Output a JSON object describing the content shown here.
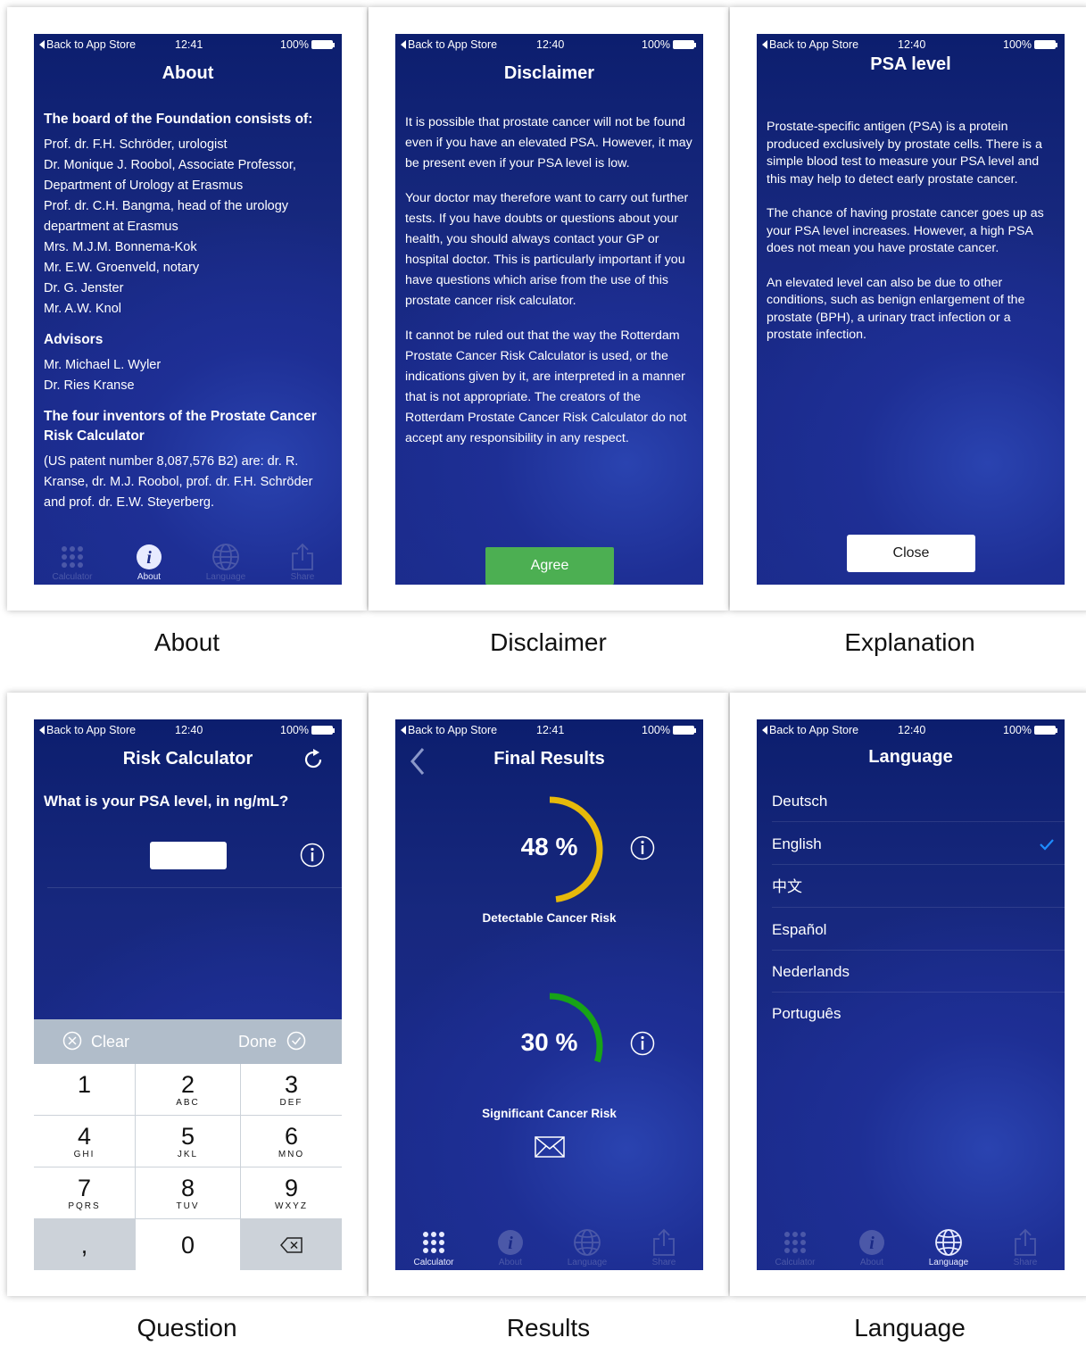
{
  "status": {
    "back": "Back to App Store",
    "battery": "100%"
  },
  "tabs": {
    "calculator": "Calculator",
    "about": "About",
    "language": "Language",
    "share": "Share"
  },
  "captions": {
    "about": "About",
    "disclaimer": "Disclaimer",
    "explanation": "Explanation",
    "question": "Question",
    "results": "Results",
    "language": "Language"
  },
  "about": {
    "time": "12:41",
    "title": "About",
    "board_heading": "The board of the Foundation consists of:",
    "board": [
      "Prof. dr. F.H. Schröder, urologist",
      "Dr. Monique J. Roobol, Associate Professor,",
      "Department of Urology at Erasmus",
      "Prof. dr. C.H. Bangma, head of the urology",
      "department at Erasmus",
      "Mrs. M.J.M. Bonnema-Kok",
      "Mr. E.W. Groenveld, notary",
      "Dr. G. Jenster",
      "Mr. A.W. Knol"
    ],
    "advisors_heading": "Advisors",
    "advisors": [
      "Mr. Michael L. Wyler",
      "Dr. Ries Kranse"
    ],
    "inventors_heading": "The four inventors of the Prostate Cancer Risk Calculator",
    "inventors_text": "(US patent number 8,087,576 B2) are: dr. R. Kranse, dr. M.J. Roobol, prof. dr. F.H. Schröder and prof. dr. E.W. Steyerberg."
  },
  "disclaimer": {
    "time": "12:40",
    "title": "Disclaimer",
    "p1": "It is possible that prostate cancer will not be found even if you have an elevated PSA. However, it may be present even if your PSA level is low.",
    "p2": "Your doctor may therefore want to carry out further tests. If you have doubts or questions about your health, you should always contact your GP or hospital doctor. This is particularly important if you have questions which arise from the use of this prostate cancer risk calculator.",
    "p3": "It cannot be ruled out that the way the Rotterdam Prostate Cancer Risk Calculator is used, or the indications given by it, are interpreted in a manner that is not appropriate. The creators of the Rotterdam Prostate Cancer Risk Calculator do not accept any responsibility in any respect.",
    "agree": "Agree"
  },
  "explanation": {
    "time": "12:40",
    "title": "PSA level",
    "p1": "Prostate-specific antigen (PSA) is a protein produced exclusively by prostate cells. There is a simple blood test to measure your PSA level and this may help to detect early prostate cancer.",
    "p2": "The chance of having prostate cancer goes up as your PSA level increases. However, a high PSA does not mean you have prostate cancer.",
    "p3": "An elevated level can also be due to other conditions, such as benign enlargement of the prostate (BPH), a urinary tract infection or a prostate infection.",
    "close": "Close"
  },
  "question": {
    "time": "12:40",
    "title": "Risk Calculator",
    "question": "What is your PSA level, in ng/mL?",
    "input_value": "",
    "clear": "Clear",
    "done": "Done",
    "keys": [
      {
        "n": "1",
        "s": ""
      },
      {
        "n": "2",
        "s": "ABC"
      },
      {
        "n": "3",
        "s": "DEF"
      },
      {
        "n": "4",
        "s": "GHI"
      },
      {
        "n": "5",
        "s": "JKL"
      },
      {
        "n": "6",
        "s": "MNO"
      },
      {
        "n": "7",
        "s": "PQRS"
      },
      {
        "n": "8",
        "s": "TUV"
      },
      {
        "n": "9",
        "s": "WXYZ"
      }
    ],
    "comma": ",",
    "zero": "0"
  },
  "results": {
    "time": "12:41",
    "title": "Final Results",
    "detectable_value": "48 %",
    "detectable_fraction": 0.48,
    "detectable_label": "Detectable Cancer Risk",
    "detectable_color": "#e6b90a",
    "significant_value": "30 %",
    "significant_fraction": 0.3,
    "significant_label": "Significant Cancer Risk",
    "significant_color": "#17a317"
  },
  "language": {
    "time": "12:40",
    "title": "Language",
    "items": [
      "Deutsch",
      "English",
      "中文",
      "Español",
      "Nederlands",
      "Português"
    ],
    "selected": "English",
    "check_color": "#1e8cff"
  }
}
